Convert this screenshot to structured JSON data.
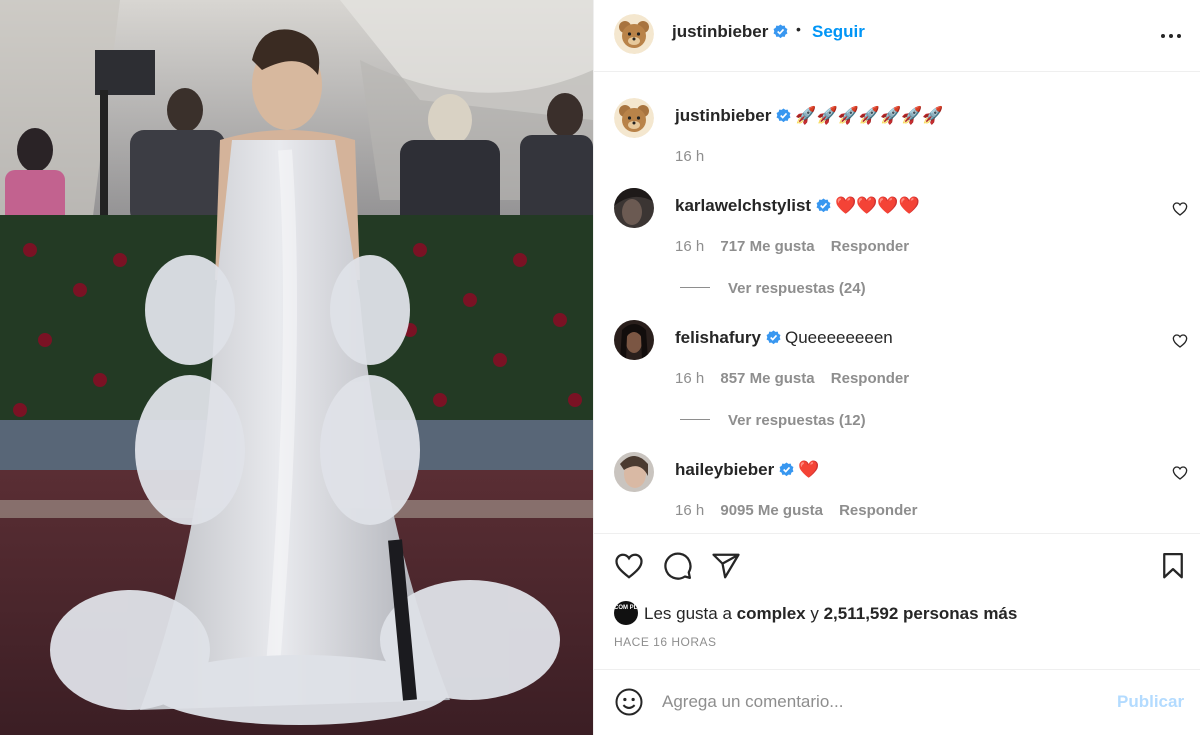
{
  "post": {
    "author": "justinbieber",
    "follow_label": "Seguir",
    "separator": "•",
    "caption_text": "🚀🚀🚀🚀🚀🚀🚀",
    "caption_time": "16 h"
  },
  "comments": [
    {
      "user": "karlawelchstylist",
      "text": "❤️❤️❤️❤️",
      "time": "16 h",
      "likes": "717 Me gusta",
      "reply_label": "Responder",
      "view_replies": "Ver respuestas (24)"
    },
    {
      "user": "felishafury",
      "text": "Queeeeeeeen",
      "time": "16 h",
      "likes": "857 Me gusta",
      "reply_label": "Responder",
      "view_replies": "Ver respuestas (12)"
    },
    {
      "user": "haileybieber",
      "text": "❤️",
      "time": "16 h",
      "likes": "9095 Me gusta",
      "reply_label": "Responder"
    }
  ],
  "likes_line": {
    "liker_logo": "COM PLEX",
    "prefix": "Les gusta a",
    "liker": "complex",
    "connector": "y",
    "others": "2,511,592 personas más"
  },
  "posted_time": "HACE 16 HORAS",
  "comment_box": {
    "placeholder": "Agrega un comentario...",
    "publish_label": "Publicar"
  },
  "colors": {
    "accent": "#0095f6",
    "verified": "#3897f0",
    "secondary_text": "#8e8e8e",
    "publish_disabled": "#b3dbff"
  },
  "icons": [
    "verified-badge-icon",
    "more-options-icon",
    "heart-icon",
    "comment-icon",
    "share-icon",
    "bookmark-icon",
    "emoji-icon"
  ]
}
